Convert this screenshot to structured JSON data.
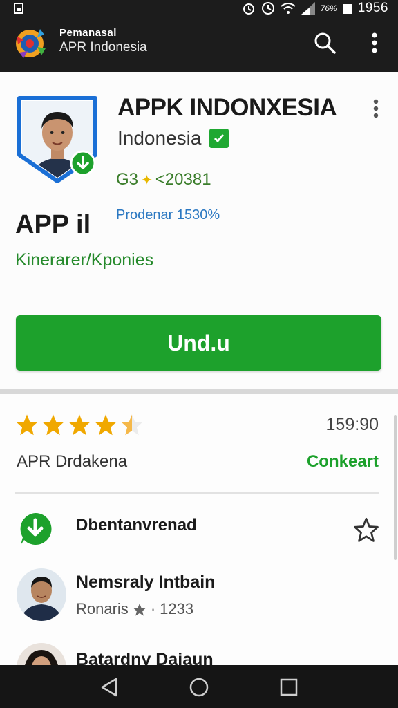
{
  "status_bar": {
    "net_label": "76%",
    "time": "1956"
  },
  "app_bar": {
    "title_small": "Pemanasal",
    "title": "APR Indonesia"
  },
  "app_card": {
    "title": "APPK INDONXESIA",
    "country": "Indonesia",
    "stats": "G3",
    "stats_value": "<20381",
    "promo": "Prodenar 1530%",
    "short_name": "APP il",
    "category": "Kinerarer/Kponies",
    "install_label": "Und.u"
  },
  "ratings": {
    "stars_filled": 4.5,
    "value": "159:90",
    "label": "APR  Drdakena",
    "link": "Conkeart"
  },
  "list": [
    {
      "label": "Dbentanvrenad"
    },
    {
      "name": "Nemsraly Intbain",
      "meta_prefix": "Ronaris",
      "meta_value": "1233"
    },
    {
      "name": "Batardny Daiaun"
    }
  ],
  "colors": {
    "accent_green": "#1da12c",
    "link_blue": "#2b78c2",
    "star_gold": "#f0a800",
    "bar_dark": "#1c1c1c"
  }
}
